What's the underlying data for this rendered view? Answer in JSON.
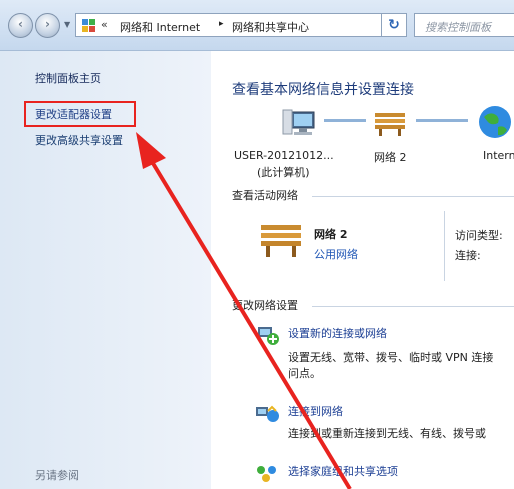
{
  "address_bar": {
    "overflow": "«",
    "crumbs": [
      "网络和 Internet",
      "网络和共享中心"
    ],
    "separator": "▸",
    "search_placeholder": "搜索控制面板"
  },
  "left_pane": {
    "links": [
      "控制面板主页",
      "更改适配器设置",
      "更改高级共享设置"
    ],
    "see_also": "另请参阅"
  },
  "main": {
    "title": "查看基本网络信息并设置连接",
    "map": {
      "computer_name": "USER-20121012...",
      "computer_sub": "(此计算机)",
      "network_name": "网络  2",
      "internet_label": "Internet"
    },
    "active_networks": {
      "section_title": "查看活动网络",
      "network_name": "网络  2",
      "network_type": "公用网络",
      "access_type_label": "访问类型:",
      "connection_label": "连接:"
    },
    "change_settings": {
      "section_title": "更改网络设置",
      "tasks": [
        {
          "link": "设置新的连接或网络",
          "desc_line1": "设置无线、宽带、拨号、临时或 VPN 连接",
          "desc_line2": "问点。"
        },
        {
          "link": "连接到网络",
          "desc_line1": "连接到或重新连接到无线、有线、拨号或"
        },
        {
          "link": "选择家庭组和共享选项"
        }
      ]
    }
  },
  "colors": {
    "annotation_red": "#e8231f",
    "link_blue": "#1f56b5",
    "title_blue": "#1e3c7b"
  }
}
